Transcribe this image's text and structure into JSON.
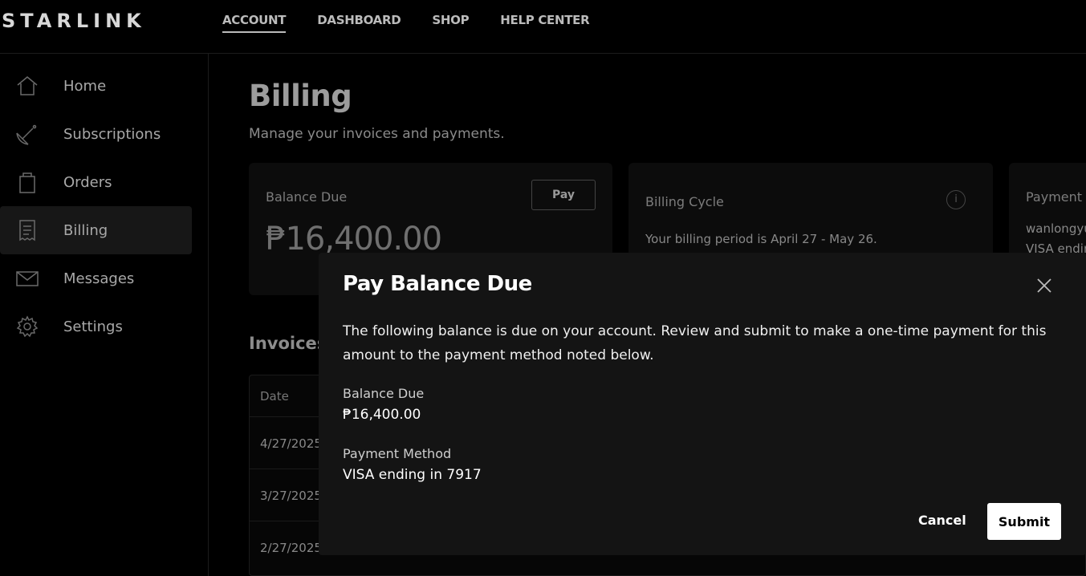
{
  "header": {
    "logo": "STARLINK",
    "nav": [
      {
        "label": "ACCOUNT",
        "active": true
      },
      {
        "label": "DASHBOARD"
      },
      {
        "label": "SHOP"
      },
      {
        "label": "HELP CENTER"
      }
    ]
  },
  "sidebar": {
    "items": [
      {
        "label": "Home",
        "icon": "home-icon"
      },
      {
        "label": "Subscriptions",
        "icon": "satellite-dish-icon"
      },
      {
        "label": "Orders",
        "icon": "bag-icon"
      },
      {
        "label": "Billing",
        "icon": "receipt-icon",
        "active": true
      },
      {
        "label": "Messages",
        "icon": "envelope-icon"
      },
      {
        "label": "Settings",
        "icon": "gear-icon"
      }
    ]
  },
  "page": {
    "title": "Billing",
    "subtitle": "Manage your invoices and payments."
  },
  "cards": {
    "balance": {
      "label": "Balance Due",
      "amount": "₱16,400.00",
      "pay_label": "Pay"
    },
    "cycle": {
      "label": "Billing Cycle",
      "text": "Your billing period is April 27 - May 26.",
      "info_glyph": "i"
    },
    "payment": {
      "label": "Payment M",
      "user": "wanlongyu",
      "card": "VISA endin"
    }
  },
  "invoices": {
    "title": "Invoices",
    "header_date": "Date",
    "rows": [
      {
        "date": "4/27/2025"
      },
      {
        "date": "3/27/2025"
      },
      {
        "date": "2/27/2025"
      }
    ]
  },
  "modal": {
    "title": "Pay Balance Due",
    "description": "The following balance is due on your account. Review and submit to make a one-time payment for this amount to the payment method noted below.",
    "balance_label": "Balance Due",
    "balance_value": "₱16,400.00",
    "method_label": "Payment Method",
    "method_value": "VISA ending in 7917",
    "cancel_label": "Cancel",
    "submit_label": "Submit"
  }
}
